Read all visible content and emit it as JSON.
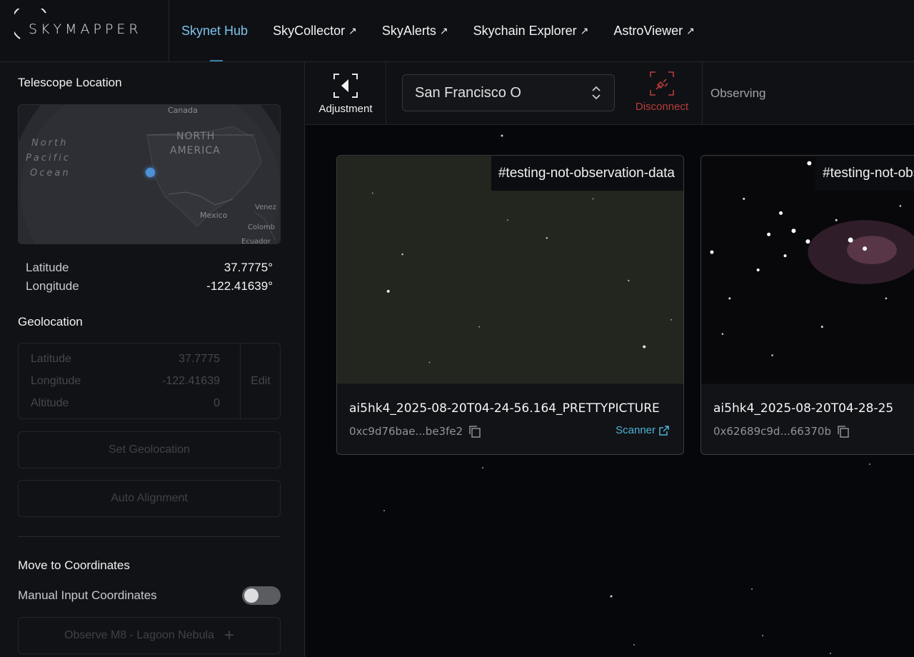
{
  "brand": {
    "name": "SKYMAPPER"
  },
  "nav": {
    "items": [
      {
        "label": "Skynet Hub",
        "external": false,
        "active": true
      },
      {
        "label": "SkyCollector",
        "external": true,
        "active": false
      },
      {
        "label": "SkyAlerts",
        "external": true,
        "active": false
      },
      {
        "label": "Skychain Explorer",
        "external": true,
        "active": false
      },
      {
        "label": "AstroViewer",
        "external": true,
        "active": false
      }
    ],
    "external_glyph": "↗"
  },
  "sidebar": {
    "telescope_location": {
      "title": "Telescope Location",
      "map_labels": {
        "canada": "Canada",
        "north_america_1": "NORTH",
        "north_america_2": "AMERICA",
        "pacific_1": "North",
        "pacific_2": "Pacific",
        "pacific_3": "Ocean",
        "mexico": "Mexico",
        "venezuela": "Venez",
        "colombia": "Colomb",
        "ecuador": "Ecuador"
      },
      "latitude_label": "Latitude",
      "latitude_value": "37.7775°",
      "longitude_label": "Longitude",
      "longitude_value": "-122.41639°"
    },
    "geolocation": {
      "title": "Geolocation",
      "rows": [
        {
          "label": "Latitude",
          "value": "37.7775"
        },
        {
          "label": "Longitude",
          "value": "-122.41639"
        },
        {
          "label": "Altitude",
          "value": "0"
        }
      ],
      "edit_label": "Edit",
      "set_button": "Set Geolocation",
      "auto_button": "Auto Alignment"
    },
    "move": {
      "title": "Move to Coordinates",
      "manual_label": "Manual Input Coordinates",
      "manual_enabled": false,
      "observe_button": "Observe M8 - Lagoon Nebula",
      "observe_icon": "+"
    }
  },
  "toolbar": {
    "adjustment_label": "Adjustment",
    "location_select": "San Francisco O",
    "disconnect_label": "Disconnect",
    "status": "Observing"
  },
  "cards": [
    {
      "tag": "#testing-not-observation-data",
      "filename": "ai5hk4_2025-08-20T04-24-56.164_PRETTYPICTURE",
      "hash": "0xc9d76bae...be3fe2",
      "link": "Scanner"
    },
    {
      "tag": "#testing-not-observation-data",
      "filename": "ai5hk4_2025-08-20T04-28-25",
      "hash": "0x62689c9d...66370b",
      "link": ""
    }
  ],
  "colors": {
    "accent": "#7cc3ea",
    "danger": "#b93c3a",
    "link": "#4fb2d6",
    "map_pin": "#4d91d8"
  }
}
